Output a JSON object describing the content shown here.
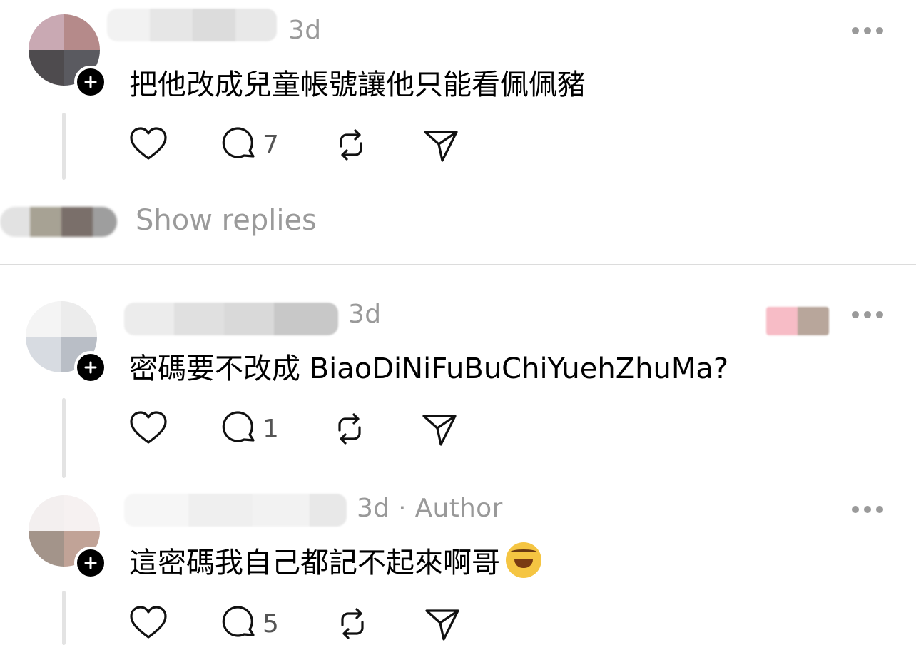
{
  "colors": {
    "meta_gray": "#999999",
    "thread_line": "#e3e3e3",
    "divider": "#dcdcdc",
    "text": "#000000"
  },
  "comments": [
    {
      "time": "3d",
      "text": "把他改成兒童帳號讓他只能看佩佩豬",
      "replies_count": "7"
    },
    {
      "time": "3d",
      "text": "密碼要不改成 BiaoDiNiFuBuChiYuehZhuMa?",
      "replies_count": "1"
    },
    {
      "time": "3d",
      "meta_suffix": "· Author",
      "text": "這密碼我自己都記不起來啊哥",
      "emoji": "rolling-on-floor-laughing",
      "replies_count": "5"
    }
  ],
  "show_replies": "Show replies",
  "icons": {
    "like": "heart-icon",
    "reply": "reply-bubble-icon",
    "repost": "repost-icon",
    "share": "send-icon",
    "more": "more-icon",
    "follow": "plus-icon"
  }
}
